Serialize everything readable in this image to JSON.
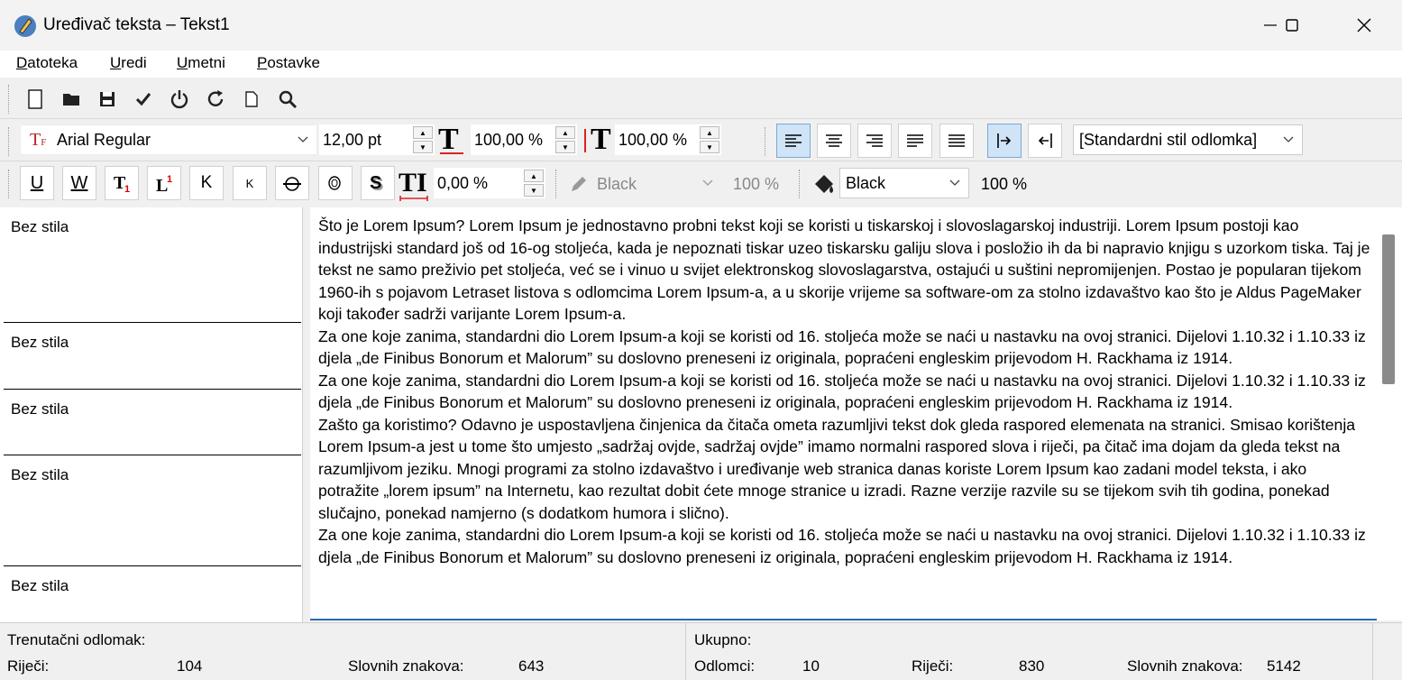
{
  "window": {
    "title": "Uređivač teksta – Tekst1"
  },
  "menu": {
    "items": [
      {
        "label": "Datoteka"
      },
      {
        "label": "Uredi"
      },
      {
        "label": "Umetni"
      },
      {
        "label": "Postavke"
      }
    ]
  },
  "toolbar1": {
    "icons": [
      "new-document-icon",
      "open-folder-icon",
      "save-icon",
      "checkmark-icon",
      "power-icon",
      "refresh-icon",
      "page-icon",
      "search-icon"
    ]
  },
  "font_toolbar": {
    "font_name": "Arial Regular",
    "font_size": "12,00 pt",
    "char_width": "100,00 %",
    "char_height": "100,00 %",
    "paragraph_style": "[Standardni stil odlomka]"
  },
  "format_toolbar": {
    "underline_label": "U",
    "word_underline_label": "W",
    "small_caps_label": "K",
    "small_k_label": "K",
    "tracking": "0,00 %",
    "stroke_color": "Black",
    "stroke_shade": "100 %",
    "fill_color": "Black",
    "fill_shade": "100 %"
  },
  "styles_pane": {
    "items": [
      "Bez stila",
      "Bez stila",
      "Bez stila",
      "Bez stila",
      "Bez stila"
    ]
  },
  "editor": {
    "paragraphs": [
      "Što je Lorem Ipsum? Lorem Ipsum je jednostavno probni tekst koji se koristi u tiskarskoj i slovoslagarskoj industriji. Lorem Ipsum postoji kao industrijski standard još od 16-og stoljeća, kada je nepoznati tiskar uzeo tiskarsku galiju slova i posložio ih da bi napravio knjigu s uzorkom tiska. Taj je tekst ne samo preživio pet stoljeća, već se i vinuo u svijet elektronskog slovoslagarstva, ostajući u suštini nepromijenjen. Postao je popularan tijekom 1960-ih s pojavom Letraset listova s odlomcima Lorem Ipsum-a, a u skorije vrijeme sa software-om za stolno izdavaštvo kao što je Aldus PageMaker koji također sadrži varijante Lorem Ipsum-a.",
      "Za one koje zanima, standardni dio Lorem Ipsum-a koji se koristi od 16. stoljeća može se naći u nastavku na ovoj stranici. Dijelovi 1.10.32 i 1.10.33 iz djela „de Finibus Bonorum et Malorum” su doslovno preneseni iz originala, popraćeni engleskim prijevodom H. Rackhama iz 1914.",
      "Za one koje zanima, standardni dio Lorem Ipsum-a koji se koristi od 16. stoljeća može se naći u nastavku na ovoj stranici. Dijelovi 1.10.32 i 1.10.33 iz djela „de Finibus Bonorum et Malorum” su doslovno preneseni iz originala, popraćeni engleskim prijevodom H. Rackhama iz 1914.",
      "Zašto ga koristimo? Odavno je uspostavljena činjenica da čitača ometa razumljivi tekst dok gleda raspored elemenata na stranici. Smisao korištenja Lorem Ipsum-a jest u tome što umjesto „sadržaj ovjde, sadržaj ovjde” imamo normalni raspored slova i riječi, pa čitač ima dojam da gleda tekst na razumljivom jeziku. Mnogi programi za stolno izdavaštvo i uređivanje web stranica danas koriste Lorem Ipsum kao zadani model teksta, i ako potražite „lorem ipsum” na Internetu, kao rezultat dobit ćete mnoge stranice u izradi. Razne verzije razvile su se tijekom svih tih godina, ponekad slučajno, ponekad namjerno (s dodatkom humora i slično).",
      "Za one koje zanima, standardni dio Lorem Ipsum-a koji se koristi od 16. stoljeća može se naći u nastavku na ovoj stranici. Dijelovi 1.10.32 i 1.10.33 iz djela „de Finibus Bonorum et Malorum” su doslovno preneseni iz originala, popraćeni engleskim prijevodom H. Rackhama iz 1914."
    ]
  },
  "status": {
    "current_label": "Trenutačni odlomak:",
    "words_label": "Riječi:",
    "words_value": "104",
    "chars_label": "Slovnih znakova:",
    "chars_value": "643",
    "total_label": "Ukupno:",
    "paragraphs_label": "Odlomci:",
    "paragraphs_value": "10",
    "total_words_label": "Riječi:",
    "total_words_value": "830",
    "total_chars_label": "Slovnih znakova:",
    "total_chars_value": "5142"
  }
}
